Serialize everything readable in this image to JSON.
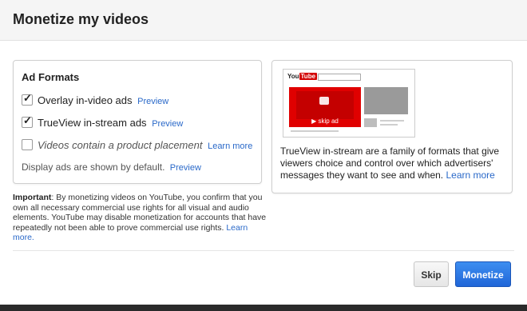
{
  "dialog": {
    "title": "Monetize my videos"
  },
  "ad_formats": {
    "title": "Ad Formats",
    "options": [
      {
        "label": "Overlay in-video ads",
        "link": "Preview",
        "checked": true
      },
      {
        "label": "TrueView in-stream ads",
        "link": "Preview",
        "checked": true
      },
      {
        "label": "Videos contain a product placement",
        "link": "Learn more",
        "checked": false
      }
    ],
    "display_note": "Display ads are shown by default.",
    "display_link": "Preview"
  },
  "important": {
    "label": "Important",
    "text": ": By monetizing videos on YouTube, you confirm that you own all necessary commercial use rights for all visual and audio elements. YouTube may disable monetization for accounts that have repeatedly not been able to prove commercial use rights.",
    "link": "Learn more."
  },
  "preview": {
    "logo_you": "You",
    "logo_tube": "Tube",
    "skip_label": "▶ skip ad",
    "description": "TrueView in-stream are a family of formats that give viewers choice and control over which advertisers' messages they want to see and when.",
    "link": "Learn more"
  },
  "buttons": {
    "skip": "Skip",
    "monetize": "Monetize"
  },
  "colors": {
    "link": "#2a69c9",
    "primary": "#2066d8",
    "video_red": "#e00000"
  }
}
